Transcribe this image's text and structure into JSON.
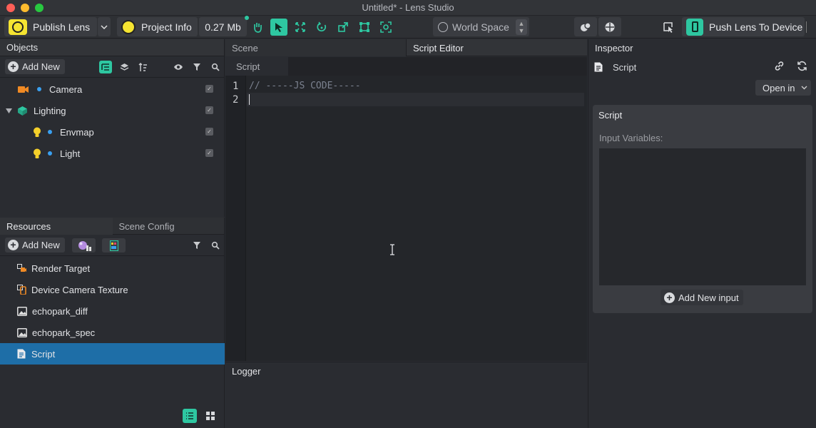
{
  "window": {
    "title": "Untitled* - Lens Studio"
  },
  "toolbar": {
    "publish_label": "Publish Lens",
    "project_info_label": "Project Info",
    "size_label": "0.27 Mb",
    "space_label": "World Space",
    "push_label": "Push Lens To Device",
    "accent": "#2ec7a1"
  },
  "objects": {
    "title": "Objects",
    "add_new": "Add New",
    "items": [
      {
        "label": "Camera",
        "icon": "camera-icon"
      },
      {
        "label": "Lighting",
        "icon": "lighting-icon"
      },
      {
        "label": "Envmap",
        "icon": "bulb-icon"
      },
      {
        "label": "Light",
        "icon": "bulb-icon"
      }
    ]
  },
  "resources": {
    "tabs": [
      "Resources",
      "Scene Config"
    ],
    "add_new": "Add New",
    "items": [
      {
        "label": "Render Target",
        "icon": "render-target-icon"
      },
      {
        "label": "Device Camera Texture",
        "icon": "device-texture-icon"
      },
      {
        "label": "echopark_diff",
        "icon": "image-icon"
      },
      {
        "label": "echopark_spec",
        "icon": "image-icon"
      },
      {
        "label": "Script",
        "icon": "script-icon",
        "selected": true
      }
    ],
    "selected_color": "#1e6ea7"
  },
  "scene": {
    "tabs": [
      "Scene",
      "Script Editor"
    ],
    "editor_tab": "Script",
    "lines": [
      "1",
      "2"
    ],
    "code": [
      "// -----JS CODE-----",
      ""
    ]
  },
  "logger": {
    "title": "Logger"
  },
  "inspector": {
    "title": "Inspector",
    "object_label": "Script",
    "open_in": "Open in",
    "card_title": "Script",
    "input_variables": "Input Variables:",
    "add_input": "Add New input"
  }
}
